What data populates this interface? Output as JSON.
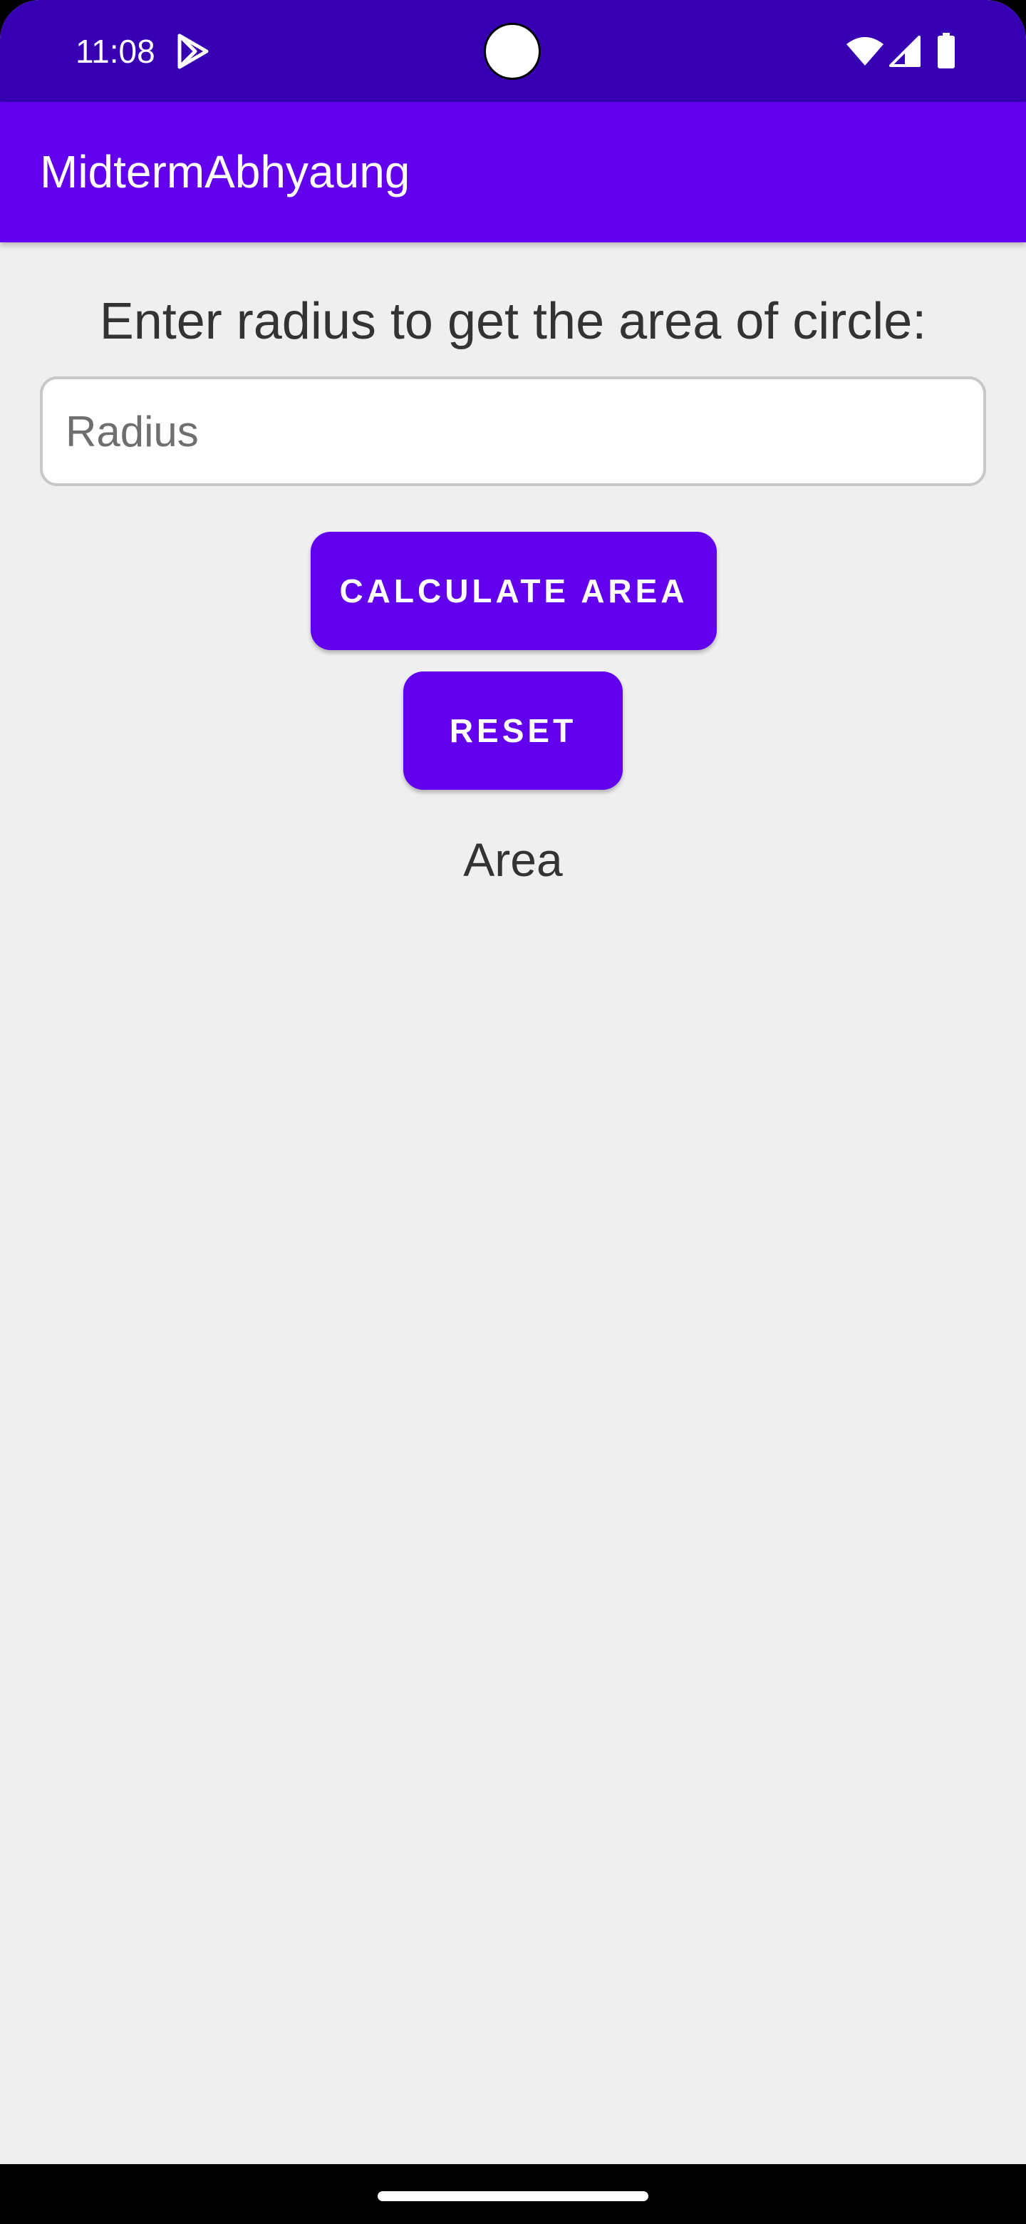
{
  "status_bar": {
    "time": "11:08",
    "icons": [
      "play-icon",
      "wifi-icon",
      "signal-icon",
      "battery-icon"
    ]
  },
  "app_bar": {
    "title": "MidtermAbhyaung"
  },
  "main": {
    "prompt": "Enter radius to get the area of circle:",
    "radius_input": {
      "placeholder": "Radius",
      "value": ""
    },
    "calculate_button_label": "CALCULATE AREA",
    "reset_button_label": "RESET",
    "result_text": "Area"
  },
  "colors": {
    "status_bar": "#3700b3",
    "primary": "#6200ee",
    "background": "#efefef",
    "text": "#333333"
  }
}
